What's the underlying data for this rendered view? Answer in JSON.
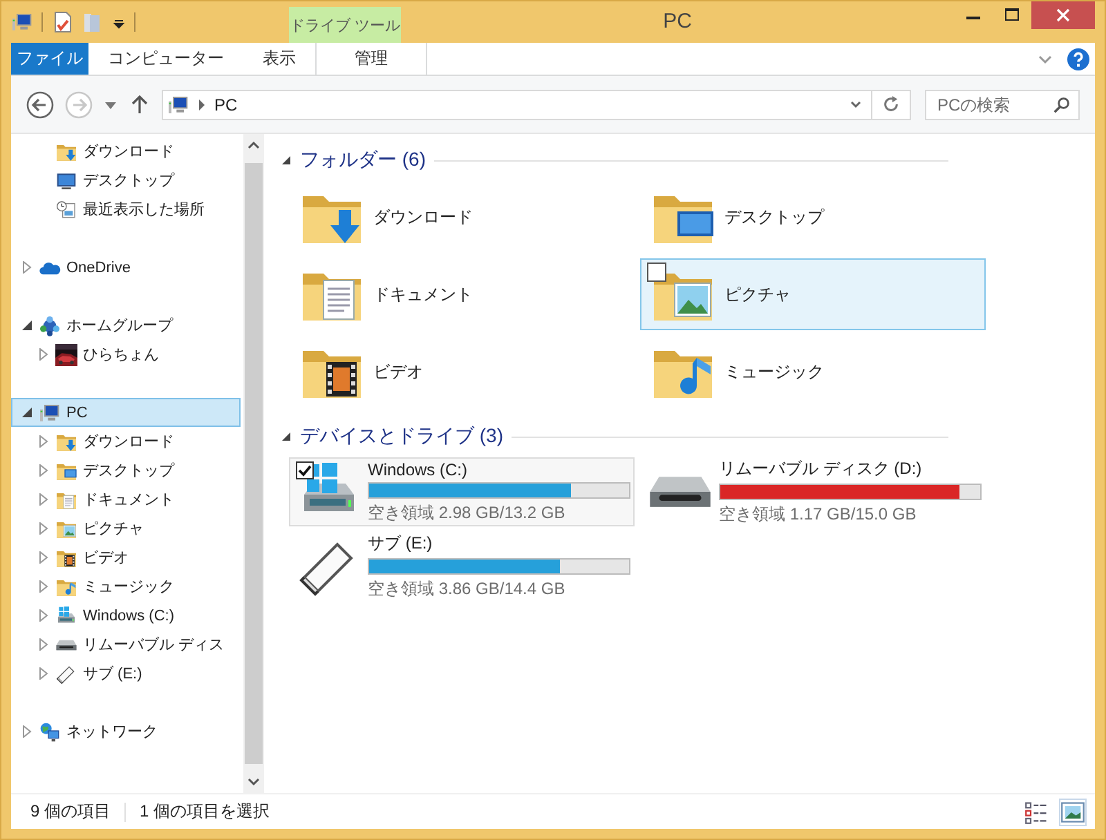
{
  "window": {
    "title": "PC"
  },
  "ribbon": {
    "context_group": "ドライブ ツール",
    "tabs": [
      {
        "label": "ファイル",
        "kind": "file",
        "selected": false
      },
      {
        "label": "コンピューター",
        "kind": "tab",
        "selected": false
      },
      {
        "label": "表示",
        "kind": "tab",
        "selected": false
      },
      {
        "label": "管理",
        "kind": "context",
        "selected": false
      }
    ]
  },
  "navigation": {
    "back": {
      "disabled": false
    },
    "forward": {
      "disabled": true
    }
  },
  "address": {
    "path": [
      "PC"
    ]
  },
  "search": {
    "placeholder": "PCの検索"
  },
  "nav": {
    "favorites_tail": [
      {
        "label": "ダウンロード",
        "kind": "folder_download"
      },
      {
        "label": "デスクトップ",
        "kind": "screen"
      },
      {
        "label": "最近表示した場所",
        "kind": "recent"
      }
    ],
    "tree": [
      {
        "label": "OneDrive",
        "kind": "cloud",
        "expanded": false,
        "selected": false
      },
      {
        "label": "ホームグループ",
        "kind": "homegroup",
        "expanded": true,
        "selected": false,
        "children": [
          {
            "label": "ひらちょん",
            "kind": "user",
            "expanded": false,
            "selected": false
          }
        ]
      },
      {
        "label": "PC",
        "kind": "pc",
        "expanded": true,
        "selected": true,
        "children": [
          {
            "label": "ダウンロード",
            "kind": "folder_download",
            "expanded": false,
            "selected": false
          },
          {
            "label": "デスクトップ",
            "kind": "folder_desktop",
            "expanded": false,
            "selected": false
          },
          {
            "label": "ドキュメント",
            "kind": "folder_documents",
            "expanded": false,
            "selected": false
          },
          {
            "label": "ピクチャ",
            "kind": "folder_pictures",
            "expanded": false,
            "selected": false
          },
          {
            "label": "ビデオ",
            "kind": "folder_videos",
            "expanded": false,
            "selected": false
          },
          {
            "label": "ミュージック",
            "kind": "folder_music",
            "expanded": false,
            "selected": false
          },
          {
            "label": "Windows (C:)",
            "kind": "system_drive",
            "expanded": false,
            "selected": false
          },
          {
            "label": "リムーバブル ディス",
            "kind": "removable",
            "expanded": false,
            "selected": false
          },
          {
            "label": "サブ (E:)",
            "kind": "usb",
            "expanded": false,
            "selected": false
          }
        ]
      },
      {
        "label": "ネットワーク",
        "kind": "network",
        "expanded": false,
        "selected": false
      }
    ]
  },
  "sections": [
    {
      "title": "フォルダー (6)",
      "kind": "folders",
      "expanded": true,
      "items": [
        {
          "label": "ダウンロード",
          "kind": "folder_download",
          "hover": false
        },
        {
          "label": "デスクトップ",
          "kind": "folder_desktop",
          "hover": false
        },
        {
          "label": "ドキュメント",
          "kind": "folder_documents",
          "hover": false
        },
        {
          "label": "ピクチャ",
          "kind": "folder_pictures",
          "hover": true
        },
        {
          "label": "ビデオ",
          "kind": "folder_videos",
          "hover": false
        },
        {
          "label": "ミュージック",
          "kind": "folder_music",
          "hover": false
        }
      ]
    },
    {
      "title": "デバイスとドライブ (3)",
      "kind": "drives",
      "expanded": true,
      "items": [
        {
          "label": "Windows (C:)",
          "kind": "system_drive",
          "selected": true,
          "level": 0.774,
          "low_space": false,
          "free": "空き領域 2.98 GB/13.2 GB"
        },
        {
          "label": "リムーバブル ディスク (D:)",
          "kind": "removable",
          "selected": false,
          "level": 0.922,
          "low_space": true,
          "free": "空き領域 1.17 GB/15.0 GB"
        },
        {
          "label": "サブ (E:)",
          "kind": "usb",
          "selected": false,
          "level": 0.732,
          "low_space": false,
          "free": "空き領域 3.86 GB/14.4 GB"
        }
      ]
    }
  ],
  "status_bar": {
    "count": "9 個の項目",
    "selection": "1 個の項目を選択",
    "views": [
      {
        "kind": "details",
        "selected": false
      },
      {
        "kind": "large_icons",
        "selected": true
      }
    ]
  }
}
